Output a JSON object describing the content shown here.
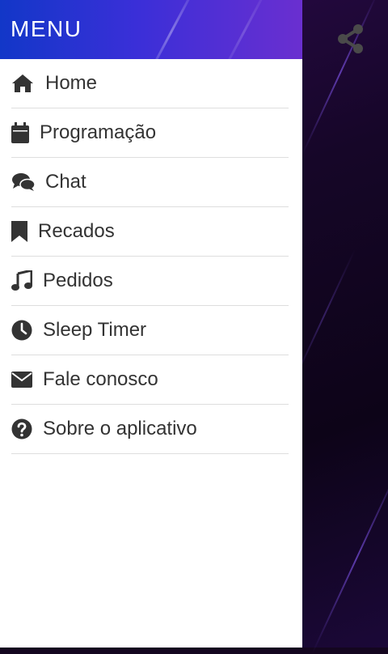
{
  "drawer": {
    "title": "MENU",
    "items": [
      {
        "label": "Home",
        "icon": "home-icon"
      },
      {
        "label": "Programação",
        "icon": "calendar-icon"
      },
      {
        "label": "Chat",
        "icon": "chat-bubbles-icon"
      },
      {
        "label": "Recados",
        "icon": "bookmark-icon"
      },
      {
        "label": "Pedidos",
        "icon": "music-note-icon"
      },
      {
        "label": "Sleep Timer",
        "icon": "clock-icon"
      },
      {
        "label": "Fale conosco",
        "icon": "envelope-icon"
      },
      {
        "label": "Sobre o aplicativo",
        "icon": "question-circle-icon"
      }
    ]
  },
  "toolbar": {
    "share_icon": "share-icon"
  },
  "colors": {
    "header_start": "#1237c8",
    "header_end": "#6a2fd0",
    "icon": "#333333",
    "background": "#14061f"
  }
}
